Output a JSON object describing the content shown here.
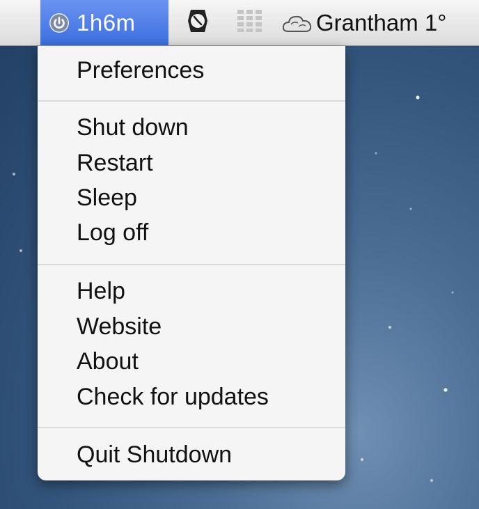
{
  "menubar": {
    "timer": "1h6m",
    "weather": "Grantham 1°",
    "icons": [
      "power-icon",
      "clock-icon",
      "grid-icon",
      "cloud-icon"
    ]
  },
  "menu": {
    "items": [
      "Preferences",
      "Shut down",
      "Restart",
      "Sleep",
      "Log off",
      "Help",
      "Website",
      "About",
      "Check for updates",
      "Quit Shutdown"
    ]
  },
  "colors": {
    "highlight": "#3b6fe0",
    "menu_bg": "#f5f5f5"
  }
}
